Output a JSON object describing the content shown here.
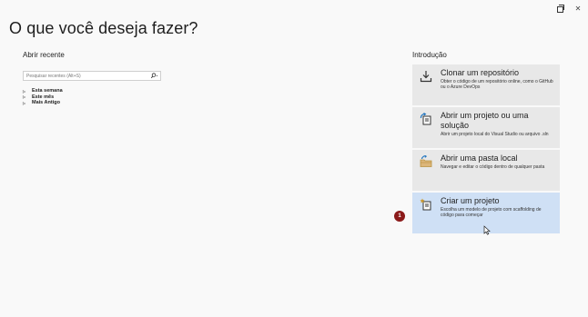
{
  "window": {
    "restore_icon": "restore-icon",
    "close_glyph": "✕"
  },
  "page": {
    "title": "O que você deseja fazer?"
  },
  "recent": {
    "title": "Abrir recente",
    "search_placeholder": "Pesquisar recentes (Alt+S)",
    "search_icon": "search-icon",
    "groups": [
      {
        "label": "Esta semana"
      },
      {
        "label": "Este mês"
      },
      {
        "label": "Mais Antigo"
      }
    ]
  },
  "intro": {
    "title": "Introdução",
    "cards": [
      {
        "title": "Clonar um repositório",
        "desc": "Obter o código de um repositório online, como o GitHub ou o Azure DevOps",
        "icon": "clone-download-icon"
      },
      {
        "title": "Abrir um projeto ou uma solução",
        "desc": "Abrir um projeto local do Visual Studio ou arquivo .sln",
        "icon": "open-project-icon"
      },
      {
        "title": "Abrir uma pasta local",
        "desc": "Navegar e editar o código dentro de qualquer pasta",
        "icon": "open-folder-icon"
      },
      {
        "title": "Criar um projeto",
        "desc": "Escolha um modelo de projeto com scaffolding de código para começar",
        "icon": "new-project-icon",
        "selected": true
      }
    ]
  },
  "annotation": {
    "step": "1"
  },
  "colors": {
    "selected_card": "#cfe0f5",
    "card": "#e8e8e8",
    "badge": "#8b1a1a",
    "accent_blue": "#1e73be"
  }
}
